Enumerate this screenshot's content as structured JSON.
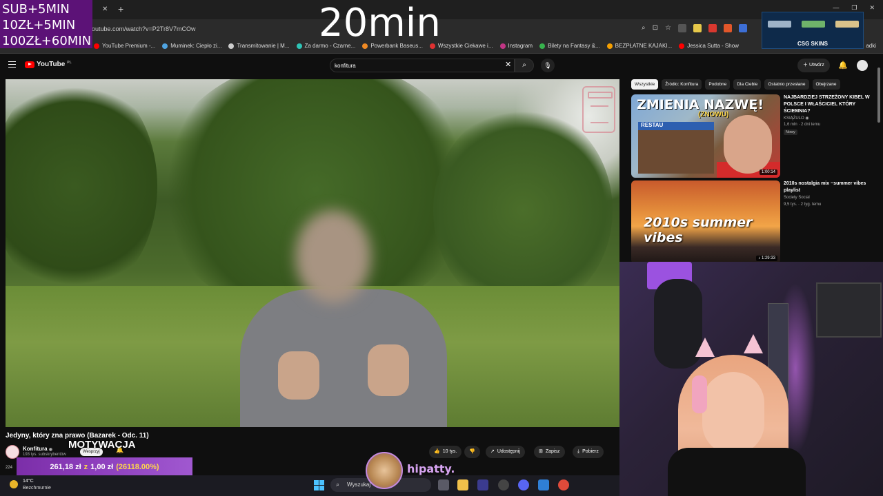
{
  "overlay": {
    "sub_lines": [
      "SUB+5MIN",
      "10ZŁ+5MIN",
      "100ZŁ+60MIN"
    ],
    "timer": "20min",
    "sponsor": "CSG SKINS"
  },
  "browser": {
    "url": "outube.com/watch?v=P2Tr8V7mCOw",
    "bookmarks": [
      {
        "label": "YouTube Premium -...",
        "color": "#ff0000"
      },
      {
        "label": "Muminek: Ciepło zi...",
        "color": "#4fa3e0"
      },
      {
        "label": "Transmitowanie | M...",
        "color": "#cccccc"
      },
      {
        "label": "Za darmo - Czarne...",
        "color": "#2ec4b6"
      },
      {
        "label": "Powerbank Baseus...",
        "color": "#f08a24"
      },
      {
        "label": "Wszystkie Ciekawe i...",
        "color": "#e03131"
      },
      {
        "label": "Instagram",
        "color": "#c13584"
      },
      {
        "label": "Bilety na Fantasy &...",
        "color": "#37b24d"
      },
      {
        "label": "BEZPŁATNE KAJAKI...",
        "color": "#f59f00"
      },
      {
        "label": "Jessica Sutta - Show",
        "color": "#ff0000"
      }
    ],
    "bookmark_end": "adki"
  },
  "youtube": {
    "logo": "YouTube",
    "logo_region": "PL",
    "search_query": "konfitura",
    "create_label": "Utwórz"
  },
  "video": {
    "title": "Jedyny, który zna prawo (Bazarek - Odc. 11)",
    "channel": "Konfitura",
    "subs": "193 tys. subskrybentów",
    "support_label": "Wesprzyj",
    "caption": "MOTYWACJA",
    "actions": {
      "likes": "10 tys.",
      "share": "Udostępnij",
      "save": "Zapisz",
      "download": "Pobierz"
    }
  },
  "chips": [
    "Wszystkie",
    "Źródło: Konfitura",
    "Podobne",
    "Dla Ciebie",
    "Ostatnio przesłane",
    "Obejrzane"
  ],
  "related": [
    {
      "thumb_text": "ZMIENIA NAZWĘ!",
      "thumb_sub": "(ZNOWU)",
      "thumb_sign": "RESTAU",
      "title": "NAJBARDZIEJ STRZEŻONY KIBEL W POLSCE I WŁAŚCICIEL KTÓRY ŚCIEMNIA?",
      "channel": "KSIĄŻULO",
      "meta": "1,6 mln · 2 dni temu",
      "badge": "Nowy",
      "duration": "1:00:14"
    },
    {
      "thumb_text": "2010s summer vibes",
      "title": "2010s nostalgia mix ~summer vibes playlist",
      "channel": "Society Social",
      "meta": "9,5 tys. · 2 tyg. temu",
      "duration": "1:29:33"
    }
  ],
  "donation": {
    "amount": "261,18 zł",
    "z": "z",
    "goal": "1,00 zł",
    "percent": "(26118.00%)",
    "left_text": "224"
  },
  "chat": {
    "username": "hipatty."
  },
  "taskbar": {
    "temp": "14°C",
    "weather": "Bezchmurnie",
    "search_placeholder": "Wyszukaj"
  }
}
